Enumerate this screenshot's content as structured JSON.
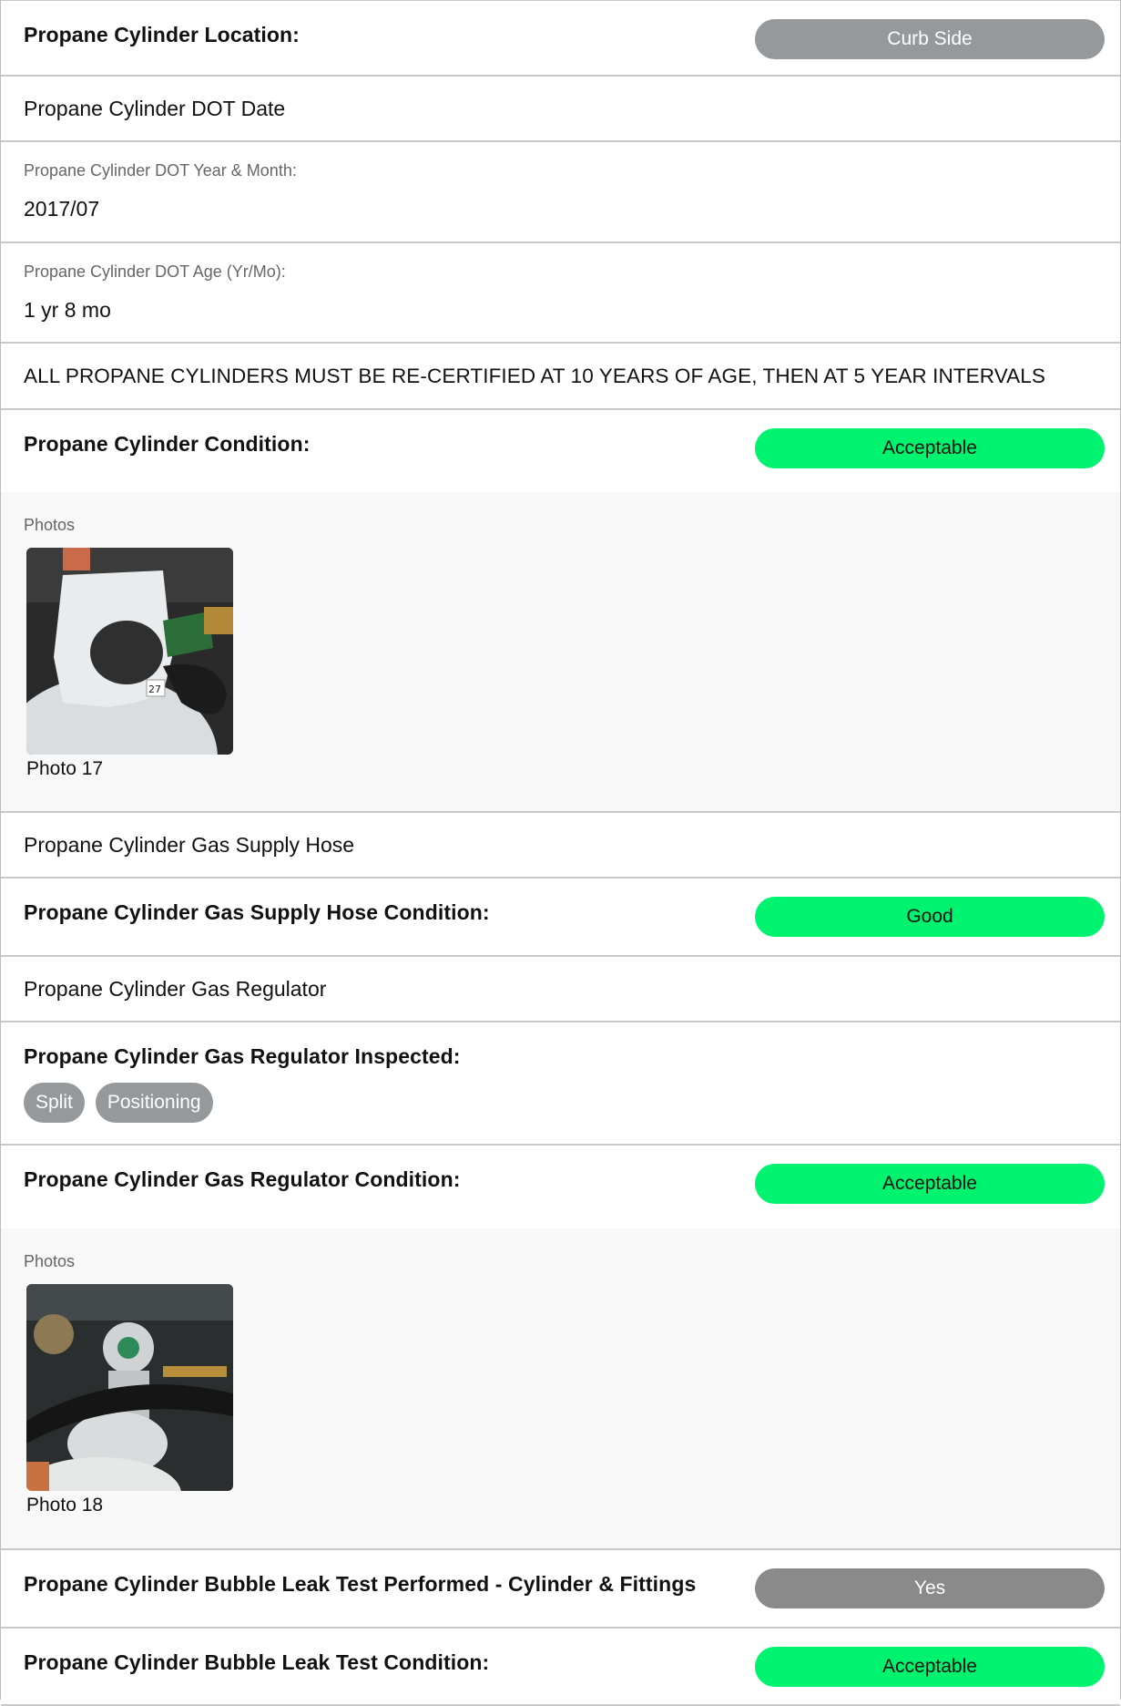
{
  "rows": {
    "location": {
      "label": "Propane Cylinder Location:",
      "value": "Curb Side"
    },
    "dot_date": {
      "title": "Propane Cylinder DOT Date"
    },
    "dot_year_month": {
      "label": "Propane Cylinder DOT Year & Month:",
      "value": "2017/07"
    },
    "dot_age": {
      "label": "Propane Cylinder DOT Age (Yr/Mo):",
      "value": "1 yr 8 mo"
    },
    "notice": {
      "text": "ALL PROPANE CYLINDERS MUST BE RE-CERTIFIED AT 10 YEARS OF AGE, THEN AT 5 YEAR INTERVALS"
    },
    "condition": {
      "label": "Propane Cylinder Condition:",
      "value": "Acceptable"
    },
    "condition_photos": {
      "label": "Photos",
      "caption": "Photo 17"
    },
    "hose": {
      "title": "Propane Cylinder Gas Supply Hose"
    },
    "hose_condition": {
      "label": "Propane Cylinder Gas Supply Hose Condition:",
      "value": "Good"
    },
    "regulator": {
      "title": "Propane Cylinder Gas Regulator"
    },
    "regulator_inspected": {
      "label": "Propane Cylinder Gas Regulator Inspected:",
      "chips": [
        "Split",
        "Positioning"
      ]
    },
    "regulator_condition": {
      "label": "Propane Cylinder Gas Regulator Condition:",
      "value": "Acceptable"
    },
    "regulator_photos": {
      "label": "Photos",
      "caption": "Photo 18"
    },
    "bubble_test": {
      "label": "Propane Cylinder Bubble Leak Test Performed - Cylinder & Fittings",
      "value": "Yes"
    },
    "bubble_condition": {
      "label": "Propane Cylinder Bubble Leak Test Condition:",
      "value": "Acceptable"
    }
  },
  "colors": {
    "pill_grey": "#95999c",
    "pill_green": "#00f36e",
    "pill_dark": "#8a8a8a",
    "photos_bg": "#f8f8f8",
    "divider": "#c9c9c9"
  },
  "icons": {
    "photo_17": "propane-cylinder-photo",
    "photo_18": "gas-regulator-photo"
  }
}
